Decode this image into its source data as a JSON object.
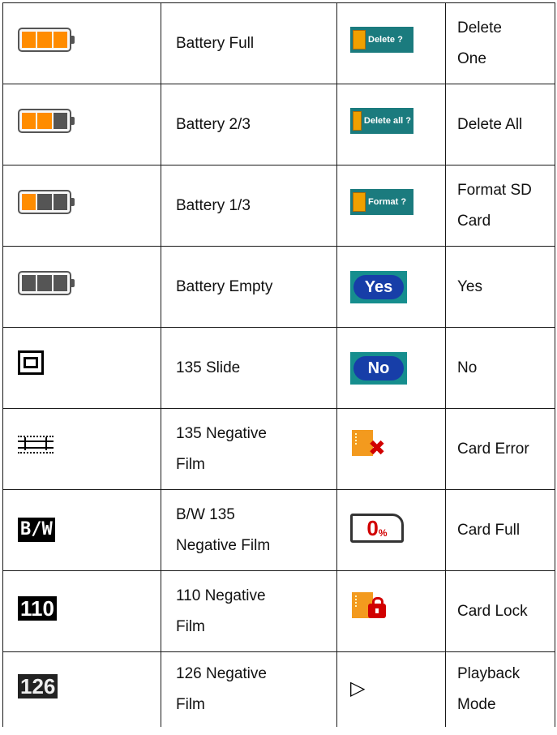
{
  "rows": [
    {
      "label1": "Battery Full",
      "icon1": "battery-full-icon",
      "icon2": "delete-one-icon",
      "icon2_text": "Delete ?",
      "label2": "Delete\nOne"
    },
    {
      "label1": "Battery 2/3",
      "icon1": "battery-two-thirds-icon",
      "icon2": "delete-all-icon",
      "icon2_text": "Delete all ?",
      "label2": "Delete All"
    },
    {
      "label1": "Battery 1/3",
      "icon1": "battery-one-third-icon",
      "icon2": "format-sd-icon",
      "icon2_text": "Format ?",
      "label2": "Format SD\nCard"
    },
    {
      "label1": "Battery Empty",
      "icon1": "battery-empty-icon",
      "icon2": "yes-icon",
      "icon2_text": "Yes",
      "label2": "Yes"
    },
    {
      "label1": "135 Slide",
      "icon1": "slide-icon",
      "icon2": "no-icon",
      "icon2_text": "No",
      "label2": "No"
    },
    {
      "label1": "135 Negative\nFilm",
      "icon1": "negative-film-icon",
      "icon2": "card-error-icon",
      "label2": "Card Error"
    },
    {
      "label1": "B/W 135\nNegative Film",
      "icon1": "bw-icon",
      "icon1_text": "B/W",
      "icon2": "card-full-icon",
      "icon2_text": "0",
      "icon2_sub": "%",
      "label2": "Card Full"
    },
    {
      "label1": "110 Negative\nFilm",
      "icon1": "film-110-icon",
      "icon1_text": "110",
      "icon2": "card-lock-icon",
      "label2": "Card Lock"
    },
    {
      "label1": "126 Negative\nFilm",
      "icon1": "film-126-icon",
      "icon1_text": "126",
      "icon2": "playback-icon",
      "icon2_text": "▷",
      "label2": "Playback\nMode"
    }
  ],
  "colors": {
    "battery_on": "#ff8c00",
    "battery_off": "#555555",
    "teal": "#1b7b7e",
    "yes_no_blue": "#173ea8",
    "sd_orange": "#f39a1e",
    "alert_red": "#d10000"
  }
}
